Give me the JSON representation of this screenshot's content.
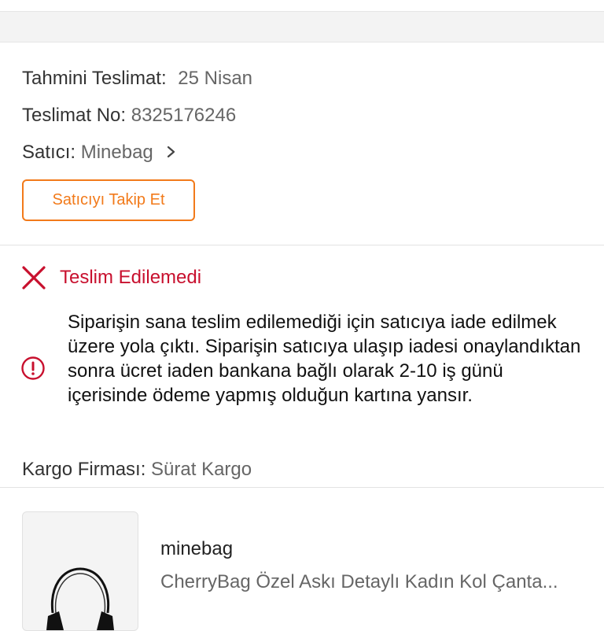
{
  "delivery": {
    "estimated_label": "Tahmini Teslimat:",
    "estimated_value": "25 Nisan",
    "number_label": "Teslimat No:",
    "number_value": "8325176246",
    "seller_label": "Satıcı:",
    "seller_value": "Minebag",
    "follow_button": "Satıcıyı Takip Et"
  },
  "status": {
    "title": "Teslim Edilemedi",
    "message": "Siparişin sana teslim edilemediği için satıcıya iade edilmek üzere yola çıktı. Siparişin satıcıya ulaşıp iadesi onaylandıktan sonra ücret iaden bankana bağlı olarak 2-10 iş günü içerisinde ödeme yapmış olduğun kartına yansır."
  },
  "cargo": {
    "label": "Kargo Firması:",
    "value": "Sürat Kargo"
  },
  "product": {
    "store": "minebag",
    "name": "CherryBag Özel Askı Detaylı Kadın Kol Çanta..."
  },
  "colors": {
    "accent": "#f27a1a",
    "error": "#c8102e"
  },
  "icons": {
    "chevron": "chevron-right-icon",
    "status": "close-icon",
    "info": "info-icon"
  }
}
